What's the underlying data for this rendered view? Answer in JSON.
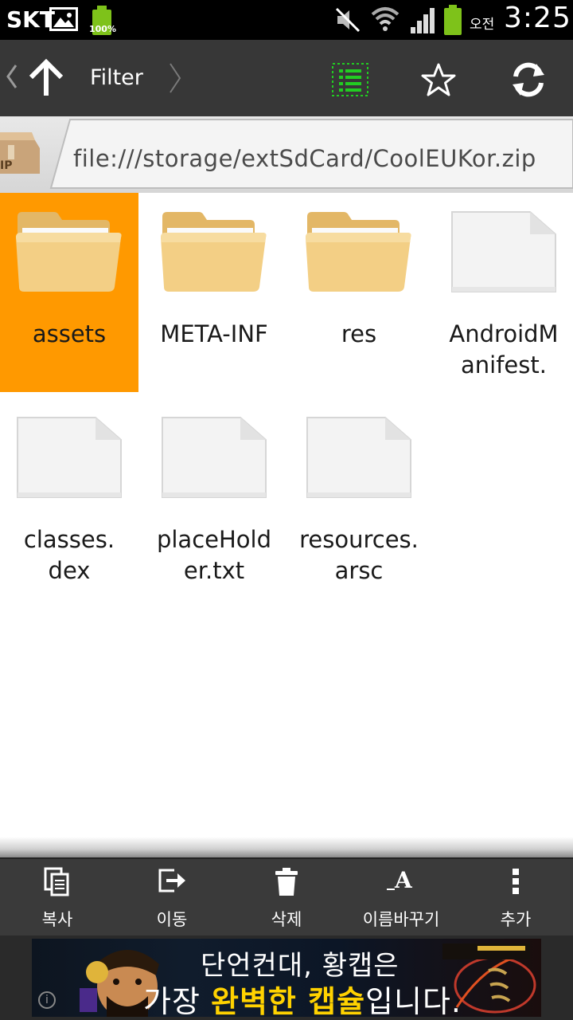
{
  "status_bar": {
    "carrier": "SKT",
    "battery_small_percent": "100%",
    "am_pm": "오전",
    "time": "3:25"
  },
  "toolbar": {
    "title": "Filter"
  },
  "path_bar": {
    "zip_label": "IP",
    "path": "file:///storage/extSdCard/CoolEUKor.zip"
  },
  "files": [
    {
      "label": "assets",
      "type": "folder",
      "selected": true
    },
    {
      "label": "META-INF",
      "type": "folder",
      "selected": false
    },
    {
      "label": "res",
      "type": "folder",
      "selected": false
    },
    {
      "label": "AndroidM\nanifest.",
      "type": "file",
      "selected": false
    },
    {
      "label": "classes.\ndex",
      "type": "file",
      "selected": false
    },
    {
      "label": "placeHold\ner.txt",
      "type": "file",
      "selected": false
    },
    {
      "label": "resources.\narsc",
      "type": "file",
      "selected": false
    }
  ],
  "actions": [
    {
      "label": "복사",
      "icon": "copy-icon"
    },
    {
      "label": "이동",
      "icon": "move-icon"
    },
    {
      "label": "삭제",
      "icon": "trash-icon"
    },
    {
      "label": "이름바꾸기",
      "icon": "rename-icon"
    },
    {
      "label": "추가",
      "icon": "more-icon"
    }
  ],
  "ad": {
    "line1": "단언컨대, 황캡은",
    "line2_pre": "가장 ",
    "line2_highlight": "완벽한 캡슐",
    "line2_post": "입니다.",
    "info": "i"
  },
  "colors": {
    "selected_tile": "#ff9900",
    "toolbar_bg": "#373737",
    "list_icon": "#22cc22"
  }
}
